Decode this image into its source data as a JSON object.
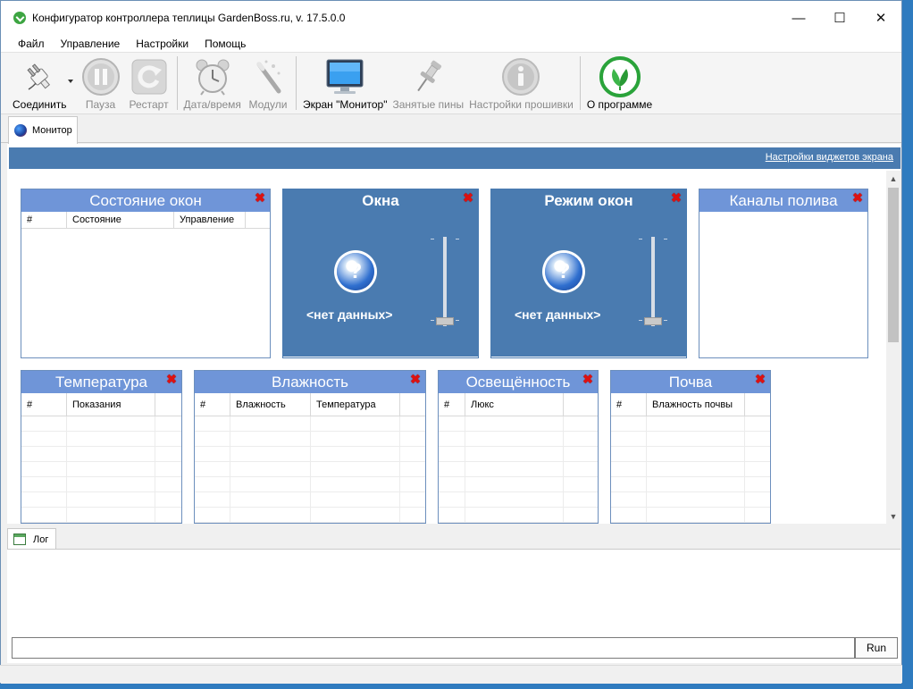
{
  "window": {
    "title": "Конфигуратор контроллера теплицы GardenBoss.ru, v. 17.5.0.0",
    "minimize": "—",
    "maximize": "☐",
    "close": "✕"
  },
  "menu": [
    "Файл",
    "Управление",
    "Настройки",
    "Помощь"
  ],
  "toolbar": {
    "connect": "Соединить",
    "pause": "Пауза",
    "restart": "Рестарт",
    "datetime": "Дата/время",
    "modules": "Модули",
    "monitor_screen": "Экран \"Монитор\"",
    "busy_pins": "Занятые пины",
    "firmware_settings": "Настройки прошивки",
    "about": "О программе"
  },
  "tabs": {
    "monitor": "Монитор",
    "log": "Лог"
  },
  "monitor": {
    "widget_settings_link": "Настройки виджетов экрана",
    "widgets": {
      "windows_state": {
        "title": "Состояние окон",
        "columns": [
          "#",
          "Состояние",
          "Управление"
        ]
      },
      "windows": {
        "title": "Окна",
        "nodata": "<нет данных>"
      },
      "windows_mode": {
        "title": "Режим окон",
        "nodata": "<нет данных>"
      },
      "watering": {
        "title": "Каналы полива"
      },
      "temperature": {
        "title": "Температура",
        "columns": [
          "#",
          "Показания"
        ]
      },
      "humidity": {
        "title": "Влажность",
        "columns": [
          "#",
          "Влажность",
          "Температура"
        ]
      },
      "light": {
        "title": "Освещённость",
        "columns": [
          "#",
          "Люкс"
        ]
      },
      "soil": {
        "title": "Почва",
        "columns": [
          "#",
          "Влажность почвы"
        ]
      }
    }
  },
  "log": {
    "run_label": "Run"
  },
  "icons": {
    "connect": "plug-icon",
    "pause": "pause-icon",
    "restart": "restart-icon",
    "datetime": "alarm-clock-icon",
    "modules": "wand-icon",
    "monitor_screen": "monitor-icon",
    "busy_pins": "pushpin-icon",
    "firmware_settings": "info-icon",
    "about": "leaf-icon"
  },
  "colors": {
    "widget_header": "#6f95d8",
    "widget_header_dark": "#4a7bb0",
    "close_x": "#dd1111"
  }
}
